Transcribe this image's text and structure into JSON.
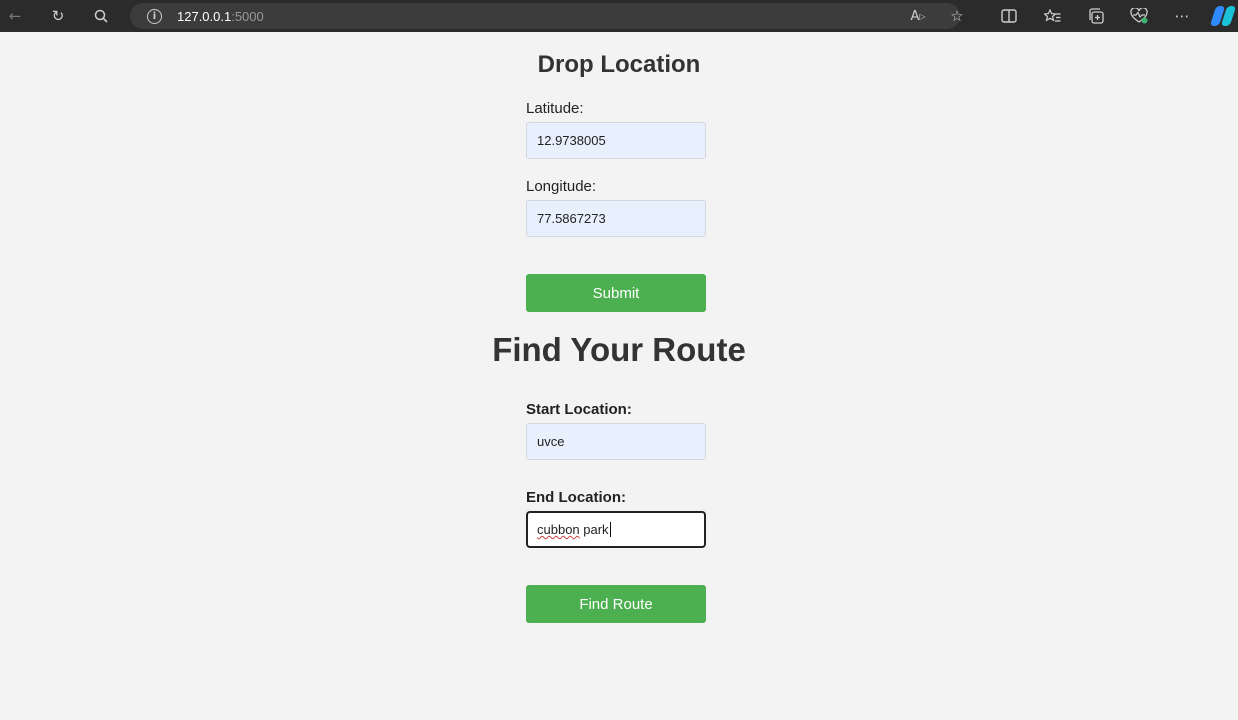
{
  "browser": {
    "url_host": "127.0.0.1",
    "url_port": ":5000"
  },
  "drop_location": {
    "title": "Drop Location",
    "latitude_label": "Latitude:",
    "latitude_value": "12.9738005",
    "longitude_label": "Longitude:",
    "longitude_value": "77.5867273",
    "submit_label": "Submit"
  },
  "find_route": {
    "title": "Find Your Route",
    "start_label": "Start Location:",
    "start_value": "uvce",
    "end_label": "End Location:",
    "end_value_misspelled": "cubbon",
    "end_value_rest": " park",
    "button_label": "Find Route"
  },
  "colors": {
    "accent_green": "#4caf50",
    "autofill_blue": "#e8f0fe",
    "page_bg": "#f3f3f3"
  }
}
